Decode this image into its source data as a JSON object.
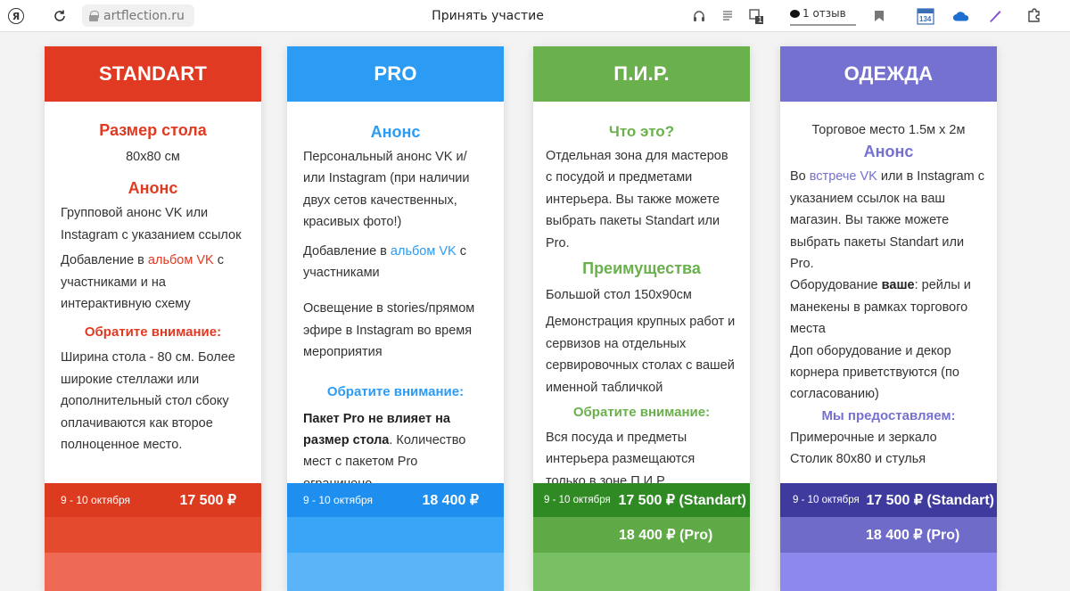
{
  "browser": {
    "url": "artflection.ru",
    "title": "Принять участие",
    "reviews_label": "1 отзыв",
    "badge_134": "134",
    "badge_1": "1"
  },
  "colors": {
    "standart": "#e03a22",
    "pro": "#2b9bf4",
    "pir": "#6ab04c",
    "odezhda": "#7571d0"
  },
  "cards": [
    {
      "title": "STANDART",
      "s1_heading": "Размер стола",
      "s1_text": "80x80 см",
      "s2_heading": "Анонс",
      "s2_p1": "Групповой анонс VK или Instagram с указанием ссылок",
      "s2_p2_pre": "Добавление в ",
      "s2_p2_link": "альбом VK",
      "s2_p2_post": " с участниками и на интерактивную схему",
      "s3_heading": "Обратите внимание:",
      "s3_text": "Ширина стола - 80 см. Более широкие стеллажи или дополнительный стол сбоку оплачиваются как второе полноценное место.",
      "date": "9 - 10 октября",
      "price": "17 500 ₽"
    },
    {
      "title": "PRO",
      "s1_heading": "Анонс",
      "s1_text": "Персональный анонс VK и/или Instagram (при наличии двух сетов качественных, красивых фото!)",
      "s2_p_pre": "Добавление в ",
      "s2_p_link": "альбом VK",
      "s2_p_post": " с участниками",
      "s3_text": "Освещение в stories/прямом эфире в Instagram во время мероприятия",
      "s4_heading": "Обратите внимание:",
      "s4_bold": "Пакет Pro не влияет на размер стола",
      "s4_text": ". Количество мест с пакетом Pro ограничено.",
      "date": "9 - 10 октября",
      "price": "18 400 ₽"
    },
    {
      "title": "П.И.Р.",
      "s1_heading": "Что это?",
      "s1_text": "Отдельная зона для мастеров с посудой и предметами интерьера. Вы также можете выбрать пакеты Standart или Pro.",
      "s2_heading": "Преимущества",
      "s2_p1": "Большой стол 150x90см",
      "s2_p2": "Демонстрация крупных работ и сервизов на отдельных сервировочных столах с вашей именной табличкой",
      "s3_heading": "Обратите внимание:",
      "s3_text": "Вся посуда и предметы интерьера размещаются только в зоне П.И.Р.",
      "date": "9 - 10 октября",
      "price1": "17 500 ₽ (Standart)",
      "price2": "18 400 ₽ (Pro)"
    },
    {
      "title": "ОДЕЖДА",
      "s0_text": "Торговое место 1.5м x 2м",
      "s1_heading": "Анонс",
      "s1_pre": "Во ",
      "s1_link": "встрече VK",
      "s1_post": " или в Instagram с указанием ссылок на ваш магазин. Вы также можете выбрать пакеты Standart или Pro.",
      "s2_pre": "Оборудование ",
      "s2_bold": "ваше",
      "s2_post": ": рейлы и манекены в рамках торгового места",
      "s3_text": "Доп оборудование и декор корнера приветствуются (по согласованию)",
      "s4_heading": "Мы предоставляем:",
      "s4_text": "Примерочные и зеркало Столик 80x80 и стулья",
      "date": "9 - 10 октября",
      "price1": "17 500 ₽ (Standart)",
      "price2": "18 400 ₽ (Pro)"
    }
  ]
}
